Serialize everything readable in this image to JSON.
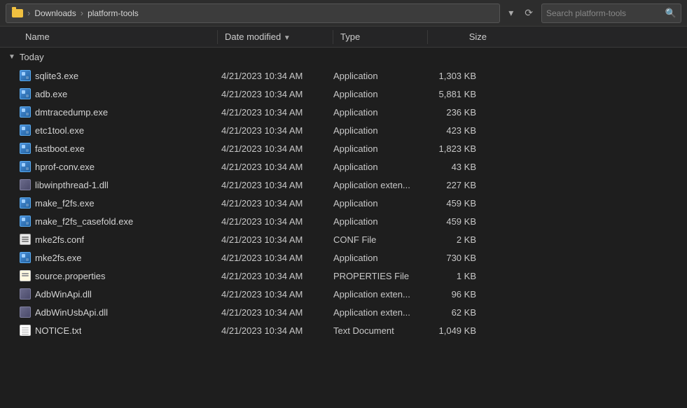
{
  "addressBar": {
    "folderIconLabel": "folder",
    "breadcrumb": [
      "Downloads",
      "platform-tools"
    ],
    "dropdownLabel": "▾",
    "refreshLabel": "⟳",
    "searchPlaceholder": "Search platform-tools"
  },
  "columns": {
    "name": "Name",
    "dateModified": "Date modified",
    "type": "Type",
    "size": "Size"
  },
  "groups": [
    {
      "name": "Today",
      "files": [
        {
          "name": "sqlite3.exe",
          "date": "4/21/2023 10:34 AM",
          "type": "Application",
          "size": "1,303 KB",
          "icon": "exe"
        },
        {
          "name": "adb.exe",
          "date": "4/21/2023 10:34 AM",
          "type": "Application",
          "size": "5,881 KB",
          "icon": "exe"
        },
        {
          "name": "dmtracedump.exe",
          "date": "4/21/2023 10:34 AM",
          "type": "Application",
          "size": "236 KB",
          "icon": "exe"
        },
        {
          "name": "etc1tool.exe",
          "date": "4/21/2023 10:34 AM",
          "type": "Application",
          "size": "423 KB",
          "icon": "exe"
        },
        {
          "name": "fastboot.exe",
          "date": "4/21/2023 10:34 AM",
          "type": "Application",
          "size": "1,823 KB",
          "icon": "exe"
        },
        {
          "name": "hprof-conv.exe",
          "date": "4/21/2023 10:34 AM",
          "type": "Application",
          "size": "43 KB",
          "icon": "exe"
        },
        {
          "name": "libwinpthread-1.dll",
          "date": "4/21/2023 10:34 AM",
          "type": "Application exten...",
          "size": "227 KB",
          "icon": "dll"
        },
        {
          "name": "make_f2fs.exe",
          "date": "4/21/2023 10:34 AM",
          "type": "Application",
          "size": "459 KB",
          "icon": "exe"
        },
        {
          "name": "make_f2fs_casefold.exe",
          "date": "4/21/2023 10:34 AM",
          "type": "Application",
          "size": "459 KB",
          "icon": "exe"
        },
        {
          "name": "mke2fs.conf",
          "date": "4/21/2023 10:34 AM",
          "type": "CONF File",
          "size": "2 KB",
          "icon": "conf"
        },
        {
          "name": "mke2fs.exe",
          "date": "4/21/2023 10:34 AM",
          "type": "Application",
          "size": "730 KB",
          "icon": "exe"
        },
        {
          "name": "source.properties",
          "date": "4/21/2023 10:34 AM",
          "type": "PROPERTIES File",
          "size": "1 KB",
          "icon": "properties"
        },
        {
          "name": "AdbWinApi.dll",
          "date": "4/21/2023 10:34 AM",
          "type": "Application exten...",
          "size": "96 KB",
          "icon": "dll"
        },
        {
          "name": "AdbWinUsbApi.dll",
          "date": "4/21/2023 10:34 AM",
          "type": "Application exten...",
          "size": "62 KB",
          "icon": "dll"
        },
        {
          "name": "NOTICE.txt",
          "date": "4/21/2023 10:34 AM",
          "type": "Text Document",
          "size": "1,049 KB",
          "icon": "txt"
        }
      ]
    }
  ]
}
